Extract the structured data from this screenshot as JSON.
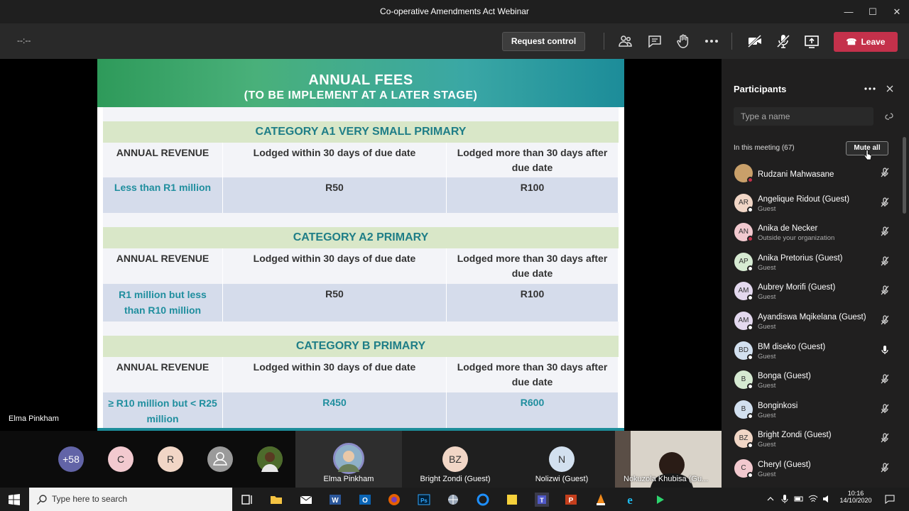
{
  "window": {
    "title": "Co-operative Amendments Act Webinar",
    "controls": [
      "—",
      "☐",
      "✕"
    ]
  },
  "toolbar": {
    "timer": "--:--",
    "request_control": "Request control",
    "leave": "Leave"
  },
  "slide": {
    "title": "ANNUAL FEES",
    "subtitle": "(TO BE IMPLEMENT AT A LATER STAGE)",
    "sections": [
      {
        "category": "CATEGORY A1 VERY SMALL PRIMARY",
        "headers": [
          "ANNUAL REVENUE",
          "Lodged within 30 days of due date",
          "Lodged more than 30 days after due date"
        ],
        "values": [
          "Less than R1 million",
          "R50",
          "R100"
        ]
      },
      {
        "category": "CATEGORY A2 PRIMARY",
        "headers": [
          "ANNUAL REVENUE",
          "Lodged within 30 days of due date",
          "Lodged more than 30 days after due date"
        ],
        "values": [
          "R1 million but less than R10 million",
          "R50",
          "R100"
        ]
      },
      {
        "category": "CATEGORY B PRIMARY",
        "headers": [
          "ANNUAL REVENUE",
          "Lodged within 30 days of due date",
          "Lodged more than 30 days after due date"
        ],
        "values": [
          "≥  R10 million but < R25 million",
          "R450",
          "R600"
        ]
      }
    ]
  },
  "presenter_name": "Elma Pinkham",
  "strip": {
    "more_count": "+58",
    "avatars": [
      "C",
      "R"
    ],
    "tiles": [
      {
        "name": "Elma Pinkham"
      },
      {
        "initials": "BZ",
        "name": "Bright Zondi (Guest)"
      },
      {
        "initials": "N",
        "name": "Nolizwi (Guest)"
      },
      {
        "name": "Nokuzola Khubisa (Gu..."
      }
    ]
  },
  "participants": {
    "title": "Participants",
    "search_placeholder": "Type a name",
    "in_meeting": "In this meeting (67)",
    "mute_all": "Mute all",
    "list": [
      {
        "initials": "",
        "name": "Rudzani Mahwasane",
        "sub": "",
        "color": "#c9a06a",
        "status": "#c4314b",
        "mic": "muted"
      },
      {
        "initials": "AR",
        "name": "Angelique Ridout (Guest)",
        "sub": "Guest",
        "color": "#f1d6c6",
        "status": "#ffffff",
        "mic": "muted"
      },
      {
        "initials": "AN",
        "name": "Anika de Necker",
        "sub": "Outside your organization",
        "color": "#f2c9cf",
        "status": "#c4314b",
        "mic": "muted"
      },
      {
        "initials": "AP",
        "name": "Anika Pretorius (Guest)",
        "sub": "Guest",
        "color": "#d6ead2",
        "status": "#ffffff",
        "mic": "muted"
      },
      {
        "initials": "AM",
        "name": "Aubrey Morifi (Guest)",
        "sub": "Guest",
        "color": "#e3d8ee",
        "status": "#ffffff",
        "mic": "muted"
      },
      {
        "initials": "AM",
        "name": "Ayandiswa Mqikelana (Guest)",
        "sub": "Guest",
        "color": "#e3d8ee",
        "status": "#ffffff",
        "mic": "muted"
      },
      {
        "initials": "BD",
        "name": "BM diseko (Guest)",
        "sub": "Guest",
        "color": "#d2e0ef",
        "status": "#ffffff",
        "mic": "on"
      },
      {
        "initials": "B",
        "name": "Bonga (Guest)",
        "sub": "Guest",
        "color": "#d6ead2",
        "status": "#ffffff",
        "mic": "muted"
      },
      {
        "initials": "B",
        "name": "Bonginkosi",
        "sub": "Guest",
        "color": "#d2e0ef",
        "status": "#ffffff",
        "mic": "muted"
      },
      {
        "initials": "BZ",
        "name": "Bright Zondi (Guest)",
        "sub": "Guest",
        "color": "#f1d6c6",
        "status": "#ffffff",
        "mic": "muted"
      },
      {
        "initials": "C",
        "name": "Cheryl (Guest)",
        "sub": "Guest",
        "color": "#f2c9cf",
        "status": "#ffffff",
        "mic": "muted"
      }
    ]
  },
  "taskbar": {
    "search_placeholder": "Type here to search",
    "time": "10:16",
    "date": "14/10/2020"
  }
}
